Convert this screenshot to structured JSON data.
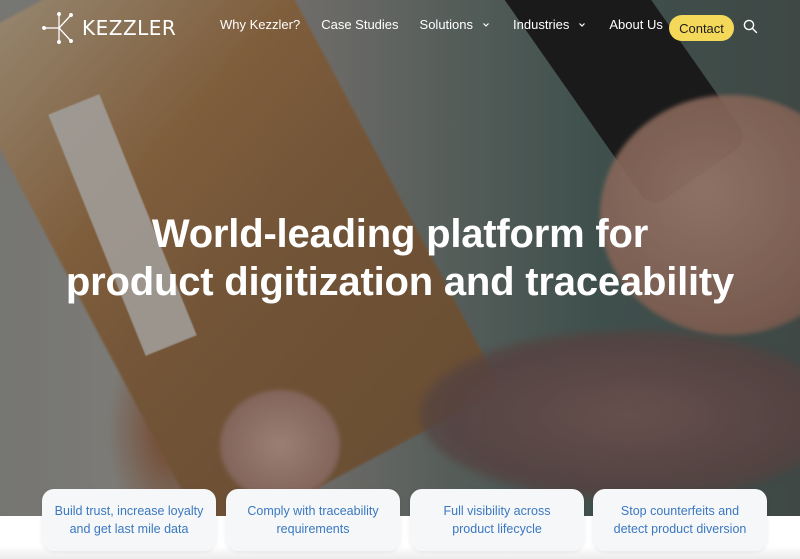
{
  "brand": {
    "name": "KEZZLER",
    "logo_icon": "kezzler-star-k-icon"
  },
  "nav": {
    "items": [
      {
        "label": "Why Kezzler?",
        "has_dropdown": false
      },
      {
        "label": "Case Studies",
        "has_dropdown": false
      },
      {
        "label": "Solutions",
        "has_dropdown": true
      },
      {
        "label": "Industries",
        "has_dropdown": true
      },
      {
        "label": "About Us",
        "has_dropdown": true
      }
    ],
    "contact_label": "Contact",
    "search_icon": "search-icon"
  },
  "hero": {
    "headline_line1": "World-leading platform for",
    "headline_line2": "product digitization and traceability"
  },
  "cards": [
    {
      "line1": "Build trust, increase loyalty",
      "line2": "and get last mile data"
    },
    {
      "line1": "Comply with traceability",
      "line2": "requirements"
    },
    {
      "line1": "Full visibility across",
      "line2": "product lifecycle"
    },
    {
      "line1": "Stop counterfeits and",
      "line2": "detect product diversion"
    }
  ],
  "colors": {
    "accent_yellow": "#f4d85a",
    "card_text_blue": "#3a78c0",
    "card_bg": "#f6f7f9",
    "header_text": "#ffffff"
  }
}
